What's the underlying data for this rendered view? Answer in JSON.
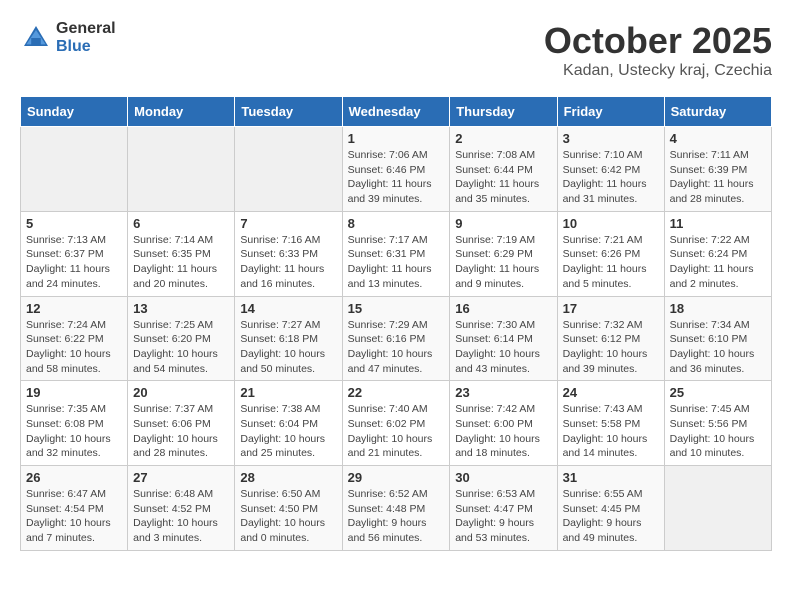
{
  "header": {
    "logo_general": "General",
    "logo_blue": "Blue",
    "month_title": "October 2025",
    "location": "Kadan, Ustecky kraj, Czechia"
  },
  "weekdays": [
    "Sunday",
    "Monday",
    "Tuesday",
    "Wednesday",
    "Thursday",
    "Friday",
    "Saturday"
  ],
  "weeks": [
    [
      {
        "day": "",
        "info": ""
      },
      {
        "day": "",
        "info": ""
      },
      {
        "day": "",
        "info": ""
      },
      {
        "day": "1",
        "info": "Sunrise: 7:06 AM\nSunset: 6:46 PM\nDaylight: 11 hours and 39 minutes."
      },
      {
        "day": "2",
        "info": "Sunrise: 7:08 AM\nSunset: 6:44 PM\nDaylight: 11 hours and 35 minutes."
      },
      {
        "day": "3",
        "info": "Sunrise: 7:10 AM\nSunset: 6:42 PM\nDaylight: 11 hours and 31 minutes."
      },
      {
        "day": "4",
        "info": "Sunrise: 7:11 AM\nSunset: 6:39 PM\nDaylight: 11 hours and 28 minutes."
      }
    ],
    [
      {
        "day": "5",
        "info": "Sunrise: 7:13 AM\nSunset: 6:37 PM\nDaylight: 11 hours and 24 minutes."
      },
      {
        "day": "6",
        "info": "Sunrise: 7:14 AM\nSunset: 6:35 PM\nDaylight: 11 hours and 20 minutes."
      },
      {
        "day": "7",
        "info": "Sunrise: 7:16 AM\nSunset: 6:33 PM\nDaylight: 11 hours and 16 minutes."
      },
      {
        "day": "8",
        "info": "Sunrise: 7:17 AM\nSunset: 6:31 PM\nDaylight: 11 hours and 13 minutes."
      },
      {
        "day": "9",
        "info": "Sunrise: 7:19 AM\nSunset: 6:29 PM\nDaylight: 11 hours and 9 minutes."
      },
      {
        "day": "10",
        "info": "Sunrise: 7:21 AM\nSunset: 6:26 PM\nDaylight: 11 hours and 5 minutes."
      },
      {
        "day": "11",
        "info": "Sunrise: 7:22 AM\nSunset: 6:24 PM\nDaylight: 11 hours and 2 minutes."
      }
    ],
    [
      {
        "day": "12",
        "info": "Sunrise: 7:24 AM\nSunset: 6:22 PM\nDaylight: 10 hours and 58 minutes."
      },
      {
        "day": "13",
        "info": "Sunrise: 7:25 AM\nSunset: 6:20 PM\nDaylight: 10 hours and 54 minutes."
      },
      {
        "day": "14",
        "info": "Sunrise: 7:27 AM\nSunset: 6:18 PM\nDaylight: 10 hours and 50 minutes."
      },
      {
        "day": "15",
        "info": "Sunrise: 7:29 AM\nSunset: 6:16 PM\nDaylight: 10 hours and 47 minutes."
      },
      {
        "day": "16",
        "info": "Sunrise: 7:30 AM\nSunset: 6:14 PM\nDaylight: 10 hours and 43 minutes."
      },
      {
        "day": "17",
        "info": "Sunrise: 7:32 AM\nSunset: 6:12 PM\nDaylight: 10 hours and 39 minutes."
      },
      {
        "day": "18",
        "info": "Sunrise: 7:34 AM\nSunset: 6:10 PM\nDaylight: 10 hours and 36 minutes."
      }
    ],
    [
      {
        "day": "19",
        "info": "Sunrise: 7:35 AM\nSunset: 6:08 PM\nDaylight: 10 hours and 32 minutes."
      },
      {
        "day": "20",
        "info": "Sunrise: 7:37 AM\nSunset: 6:06 PM\nDaylight: 10 hours and 28 minutes."
      },
      {
        "day": "21",
        "info": "Sunrise: 7:38 AM\nSunset: 6:04 PM\nDaylight: 10 hours and 25 minutes."
      },
      {
        "day": "22",
        "info": "Sunrise: 7:40 AM\nSunset: 6:02 PM\nDaylight: 10 hours and 21 minutes."
      },
      {
        "day": "23",
        "info": "Sunrise: 7:42 AM\nSunset: 6:00 PM\nDaylight: 10 hours and 18 minutes."
      },
      {
        "day": "24",
        "info": "Sunrise: 7:43 AM\nSunset: 5:58 PM\nDaylight: 10 hours and 14 minutes."
      },
      {
        "day": "25",
        "info": "Sunrise: 7:45 AM\nSunset: 5:56 PM\nDaylight: 10 hours and 10 minutes."
      }
    ],
    [
      {
        "day": "26",
        "info": "Sunrise: 6:47 AM\nSunset: 4:54 PM\nDaylight: 10 hours and 7 minutes."
      },
      {
        "day": "27",
        "info": "Sunrise: 6:48 AM\nSunset: 4:52 PM\nDaylight: 10 hours and 3 minutes."
      },
      {
        "day": "28",
        "info": "Sunrise: 6:50 AM\nSunset: 4:50 PM\nDaylight: 10 hours and 0 minutes."
      },
      {
        "day": "29",
        "info": "Sunrise: 6:52 AM\nSunset: 4:48 PM\nDaylight: 9 hours and 56 minutes."
      },
      {
        "day": "30",
        "info": "Sunrise: 6:53 AM\nSunset: 4:47 PM\nDaylight: 9 hours and 53 minutes."
      },
      {
        "day": "31",
        "info": "Sunrise: 6:55 AM\nSunset: 4:45 PM\nDaylight: 9 hours and 49 minutes."
      },
      {
        "day": "",
        "info": ""
      }
    ]
  ]
}
